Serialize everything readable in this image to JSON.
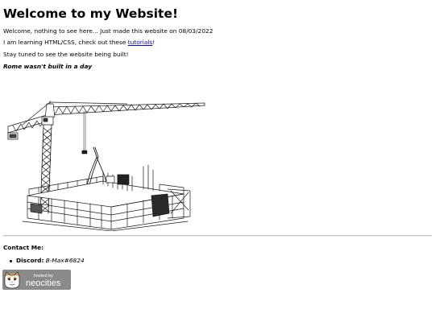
{
  "header": {
    "title": "Welcome to my Website!"
  },
  "intro": {
    "line1": "Welcome, nothing to see here... Just made this website on 08/03/2022",
    "line2_before": "I am learning HTML/CSS, check out these ",
    "line2_link": "tutorials",
    "line2_after": "!",
    "line3": "Stay tuned to see the website being built!",
    "line4": "Rome wasn't built in a day"
  },
  "image": {
    "icon": "construction-crane-illustration"
  },
  "contact": {
    "heading": "Contact Me:",
    "items": [
      {
        "label": "Discord:",
        "value": "B-Max#6824"
      }
    ]
  },
  "badge": {
    "small_text": "hosted by",
    "brand_text": "neocities",
    "icon": "neocities-cat-logo"
  },
  "colors": {
    "link": "#0000ee",
    "badge_bg": "#8a8a8a",
    "cat_orange": "#e89a3c"
  }
}
